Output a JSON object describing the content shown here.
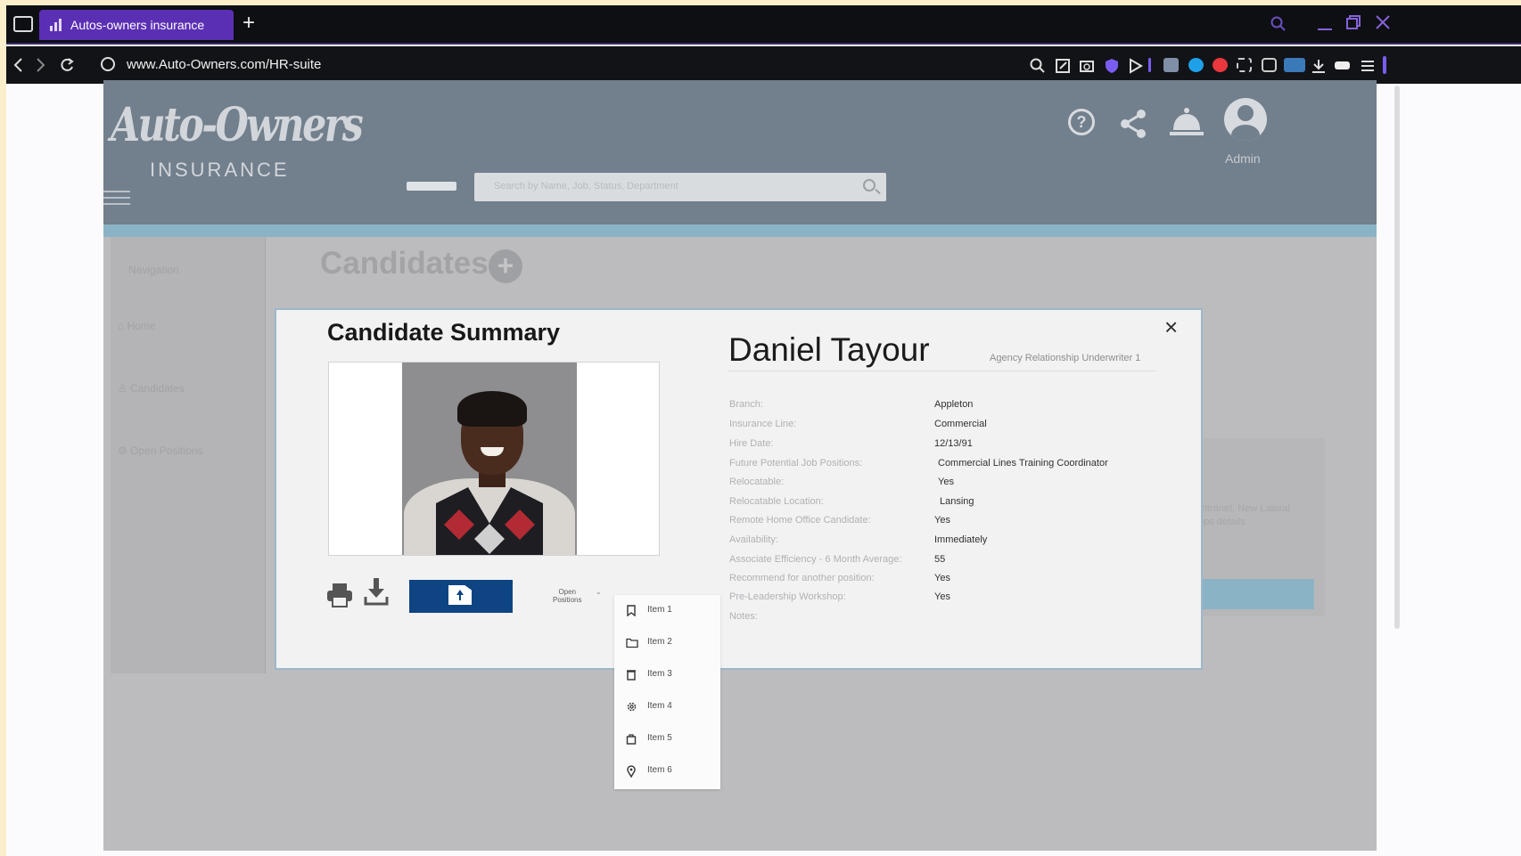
{
  "browser": {
    "tab_title": "Autos-owners insurance",
    "new_tab": "+",
    "url": "www.Auto-Owners.com/HR-suite"
  },
  "header": {
    "logo_script": "Auto-Owners",
    "logo_sub": "INSURANCE",
    "search_placeholder": "Search by Name, Job, Status, Department",
    "user_label": "Admin"
  },
  "sidenav": {
    "title": "Navigation",
    "items": [
      {
        "label": "Home",
        "icon": "home-icon"
      },
      {
        "label": "Candidates",
        "icon": "person-icon"
      },
      {
        "label": "Open Positions",
        "icon": "gear-icon"
      }
    ]
  },
  "page": {
    "title": "Candidates",
    "add_symbol": "+",
    "background_text": "Associate Intranet, New Lateral pathway apps details"
  },
  "modal": {
    "title": "Candidate Summary",
    "close_symbol": "×",
    "open_positions_label": "Open\nPositions",
    "candidate": {
      "name": "Daniel Tayour",
      "role": "Agency Relationship Underwriter 1",
      "fields": [
        {
          "label": "Branch:",
          "value": "Appleton"
        },
        {
          "label": "Insurance Line:",
          "value": "Commercial"
        },
        {
          "label": "Hire Date:",
          "value": "12/13/91"
        },
        {
          "label": "Future Potential Job Positions:",
          "value": "Commercial Lines Training Coordinator"
        },
        {
          "label": "Relocatable:",
          "value": "Yes"
        },
        {
          "label": "Relocatable Location:",
          "value": "Lansing"
        },
        {
          "label": "Remote Home Office Candidate:",
          "value": "Yes"
        },
        {
          "label": "Availability:",
          "value": "Immediately"
        },
        {
          "label": "Associate Efficiency - 6 Month Average:",
          "value": "55"
        },
        {
          "label": "Recommend for another position:",
          "value": "Yes"
        },
        {
          "label": "Pre-Leadership Workshop:",
          "value": "Yes"
        },
        {
          "label": "Notes:",
          "value": ""
        }
      ]
    }
  },
  "dropdown": {
    "items": [
      {
        "label": "Item 1",
        "icon": "bookmark-icon"
      },
      {
        "label": "Item 2",
        "icon": "folder-icon"
      },
      {
        "label": "Item 3",
        "icon": "trash-icon"
      },
      {
        "label": "Item 4",
        "icon": "gear-icon"
      },
      {
        "label": "Item 5",
        "icon": "shopping-bag-icon"
      },
      {
        "label": "Item 6",
        "icon": "map-pin-icon"
      }
    ]
  },
  "colors": {
    "header": "#727f8c",
    "accent_strip": "#8ab4c6",
    "upload_button": "#0f4482",
    "tab_active": "#5b2fb3"
  }
}
